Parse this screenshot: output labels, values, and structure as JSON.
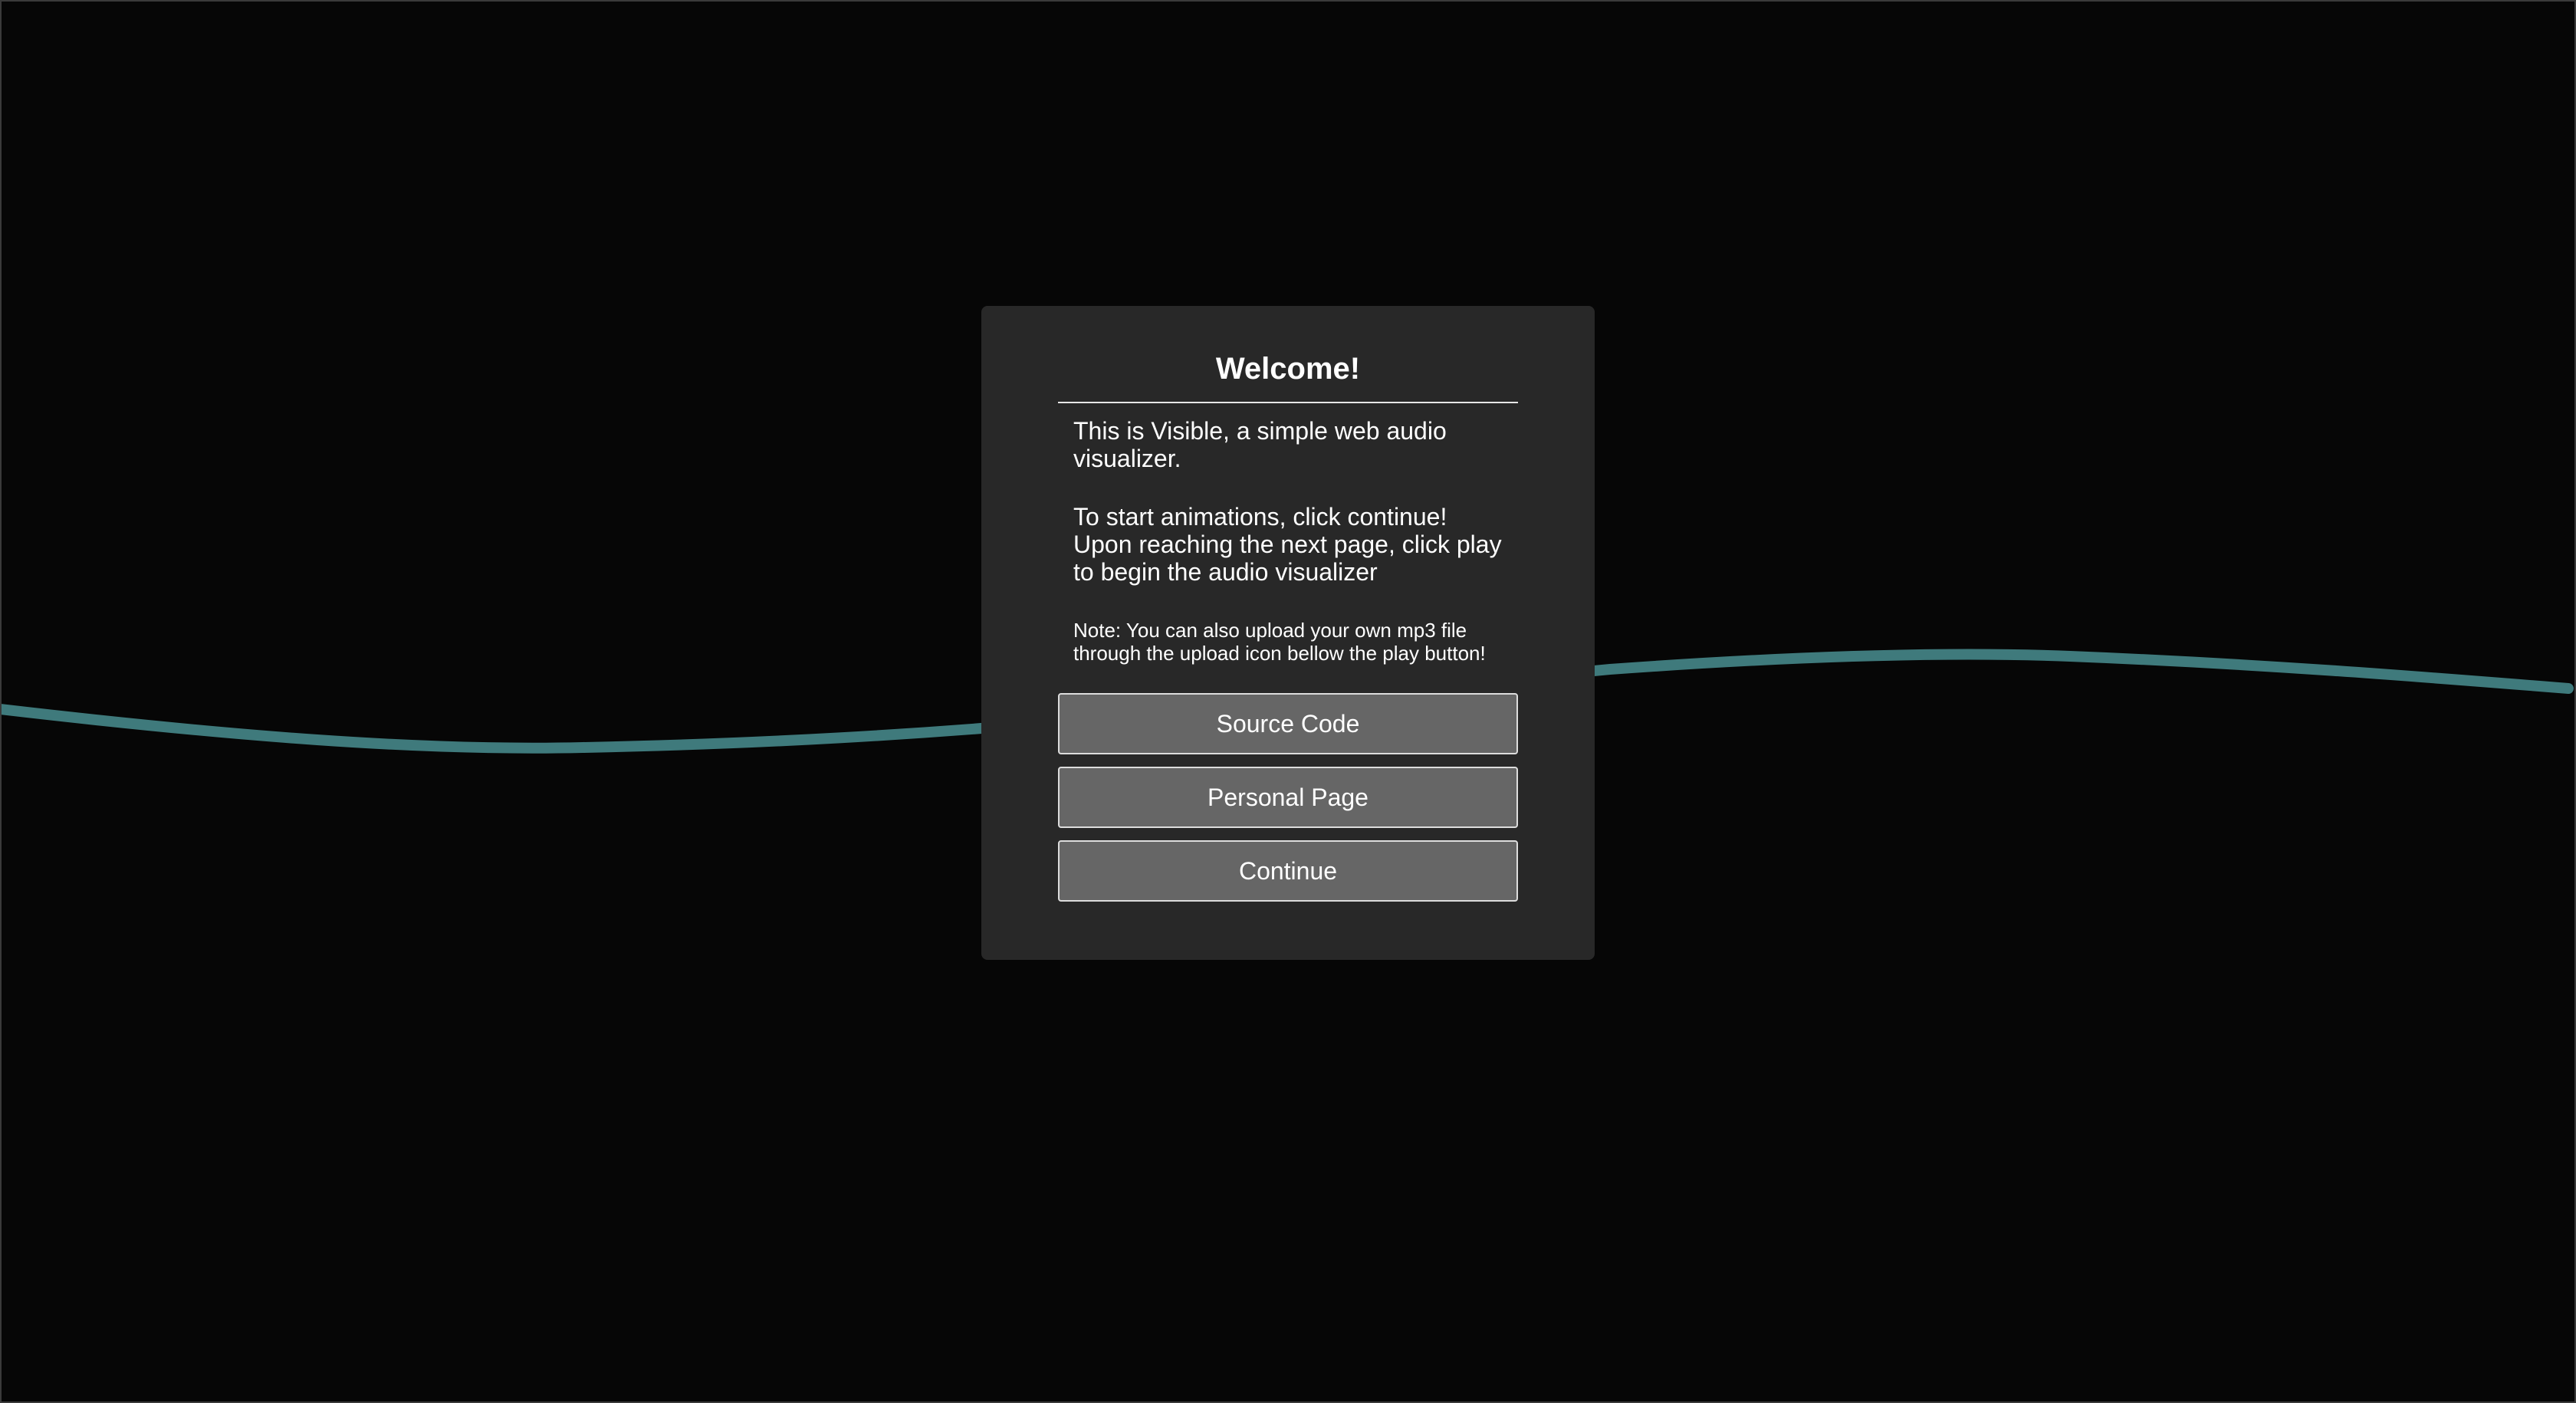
{
  "modal": {
    "title": "Welcome!",
    "intro": "This is Visible, a simple web audio visualizer.",
    "instructions_1": "To start animations, click continue!",
    "instructions_2": "Upon reaching the next page, click play to begin the audio visualizer",
    "note": "Note: You can also upload your own mp3 file through the upload icon bellow the play button!",
    "buttons": [
      {
        "label": "Source Code"
      },
      {
        "label": "Personal Page"
      },
      {
        "label": "Continue"
      }
    ]
  },
  "colors": {
    "background": "#060606",
    "wave": "#3f7a7c",
    "modal": "#282828",
    "button": "#666666"
  }
}
